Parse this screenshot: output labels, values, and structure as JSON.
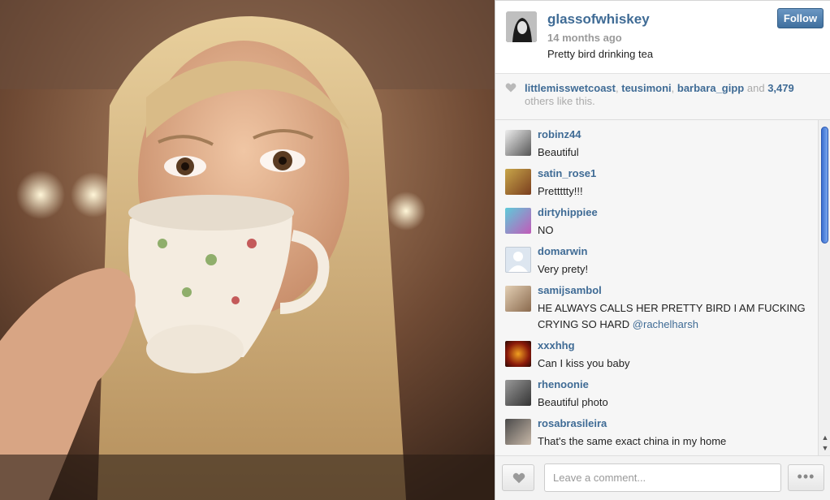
{
  "post": {
    "username": "glassofwhiskey",
    "time_ago": "14 months ago",
    "caption": "Pretty bird drinking tea",
    "follow_label": "Follow"
  },
  "likes": {
    "user1": "littlemisswetcoast",
    "user2": "teusimoni",
    "user3": "barbara_gipp",
    "and_word": "and",
    "count": "3,479",
    "suffix": "others like this."
  },
  "comments": [
    {
      "user": "robinz44",
      "text": "Beautiful"
    },
    {
      "user": "satin_rose1",
      "text": "Prettttty!!!"
    },
    {
      "user": "dirtyhippiee",
      "text": "NO"
    },
    {
      "user": "domarwin",
      "text": "Very prety!"
    },
    {
      "user": "samijsambol",
      "text": "HE ALWAYS CALLS HER PRETTY BIRD I AM FUCKING CRYING SO HARD",
      "mention": "@rachelharsh"
    },
    {
      "user": "xxxhhg",
      "text": "Can I kiss you baby"
    },
    {
      "user": "rhenoonie",
      "text": "Beautiful photo"
    },
    {
      "user": "rosabrasileira",
      "text": "That's the same exact china in my home"
    }
  ],
  "footer": {
    "comment_placeholder": "Leave a comment...",
    "more_label": "•••"
  },
  "colors": {
    "link": "#3f6b95",
    "follow_button": "#4f7fae",
    "muted": "#9a9a9a"
  },
  "icons": {
    "like": "heart-icon",
    "more": "ellipsis-icon"
  }
}
